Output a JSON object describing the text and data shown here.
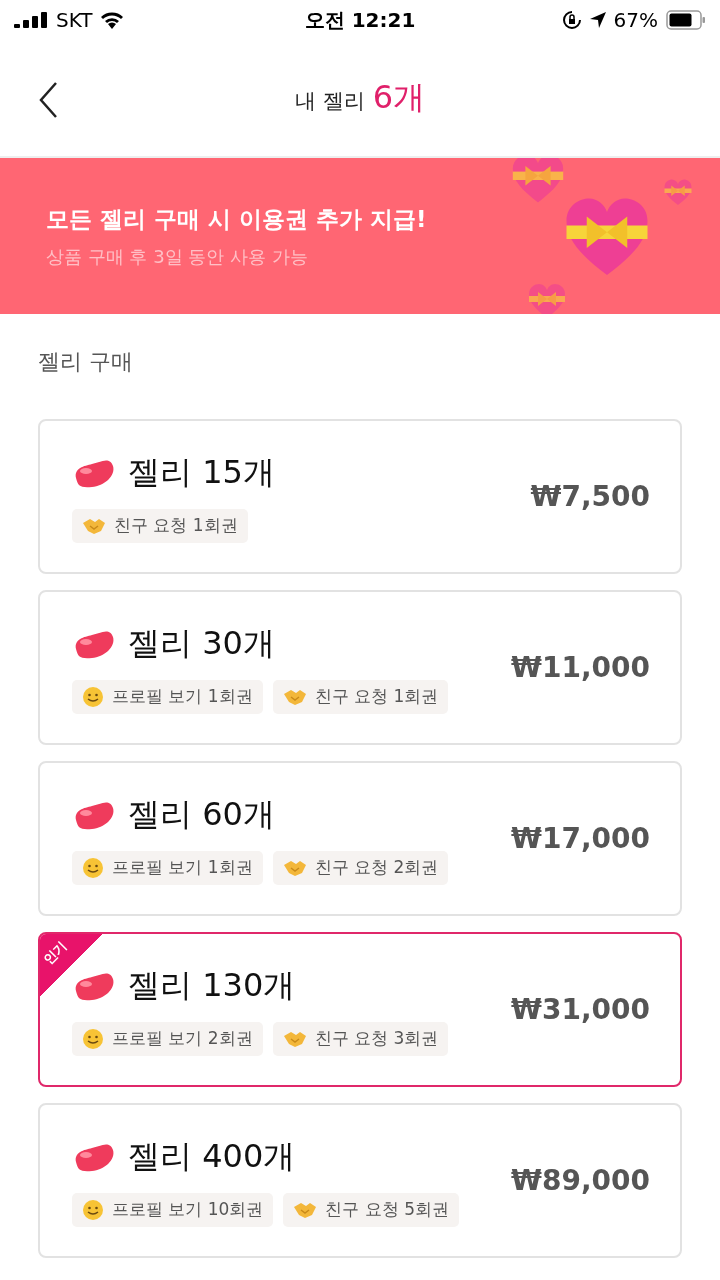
{
  "status_bar": {
    "carrier": "SKT",
    "time": "오전 12:21",
    "battery": "67%"
  },
  "header": {
    "title": "내 젤리",
    "count": "6개"
  },
  "banner": {
    "headline": "모든 젤리 구매 시 이용권 추가 지급!",
    "subtext": "상품 구매 후 3일 동안 사용 가능"
  },
  "section_title": "젤리 구매",
  "products": [
    {
      "name": "젤리 15개",
      "price": "₩7,500",
      "popular": false,
      "perks": [
        {
          "kind": "friend",
          "label": "친구 요청 1회권"
        }
      ]
    },
    {
      "name": "젤리 30개",
      "price": "₩11,000",
      "popular": false,
      "perks": [
        {
          "kind": "profile",
          "label": "프로필 보기 1회권"
        },
        {
          "kind": "friend",
          "label": "친구 요청 1회권"
        }
      ]
    },
    {
      "name": "젤리 60개",
      "price": "₩17,000",
      "popular": false,
      "perks": [
        {
          "kind": "profile",
          "label": "프로필 보기 1회권"
        },
        {
          "kind": "friend",
          "label": "친구 요청 2회권"
        }
      ]
    },
    {
      "name": "젤리 130개",
      "price": "₩31,000",
      "popular": true,
      "badge": "인기",
      "perks": [
        {
          "kind": "profile",
          "label": "프로필 보기 2회권"
        },
        {
          "kind": "friend",
          "label": "친구 요청 3회권"
        }
      ]
    },
    {
      "name": "젤리 400개",
      "price": "₩89,000",
      "popular": false,
      "perks": [
        {
          "kind": "profile",
          "label": "프로필 보기 10회권"
        },
        {
          "kind": "friend",
          "label": "친구 요청 5회권"
        }
      ]
    }
  ]
}
